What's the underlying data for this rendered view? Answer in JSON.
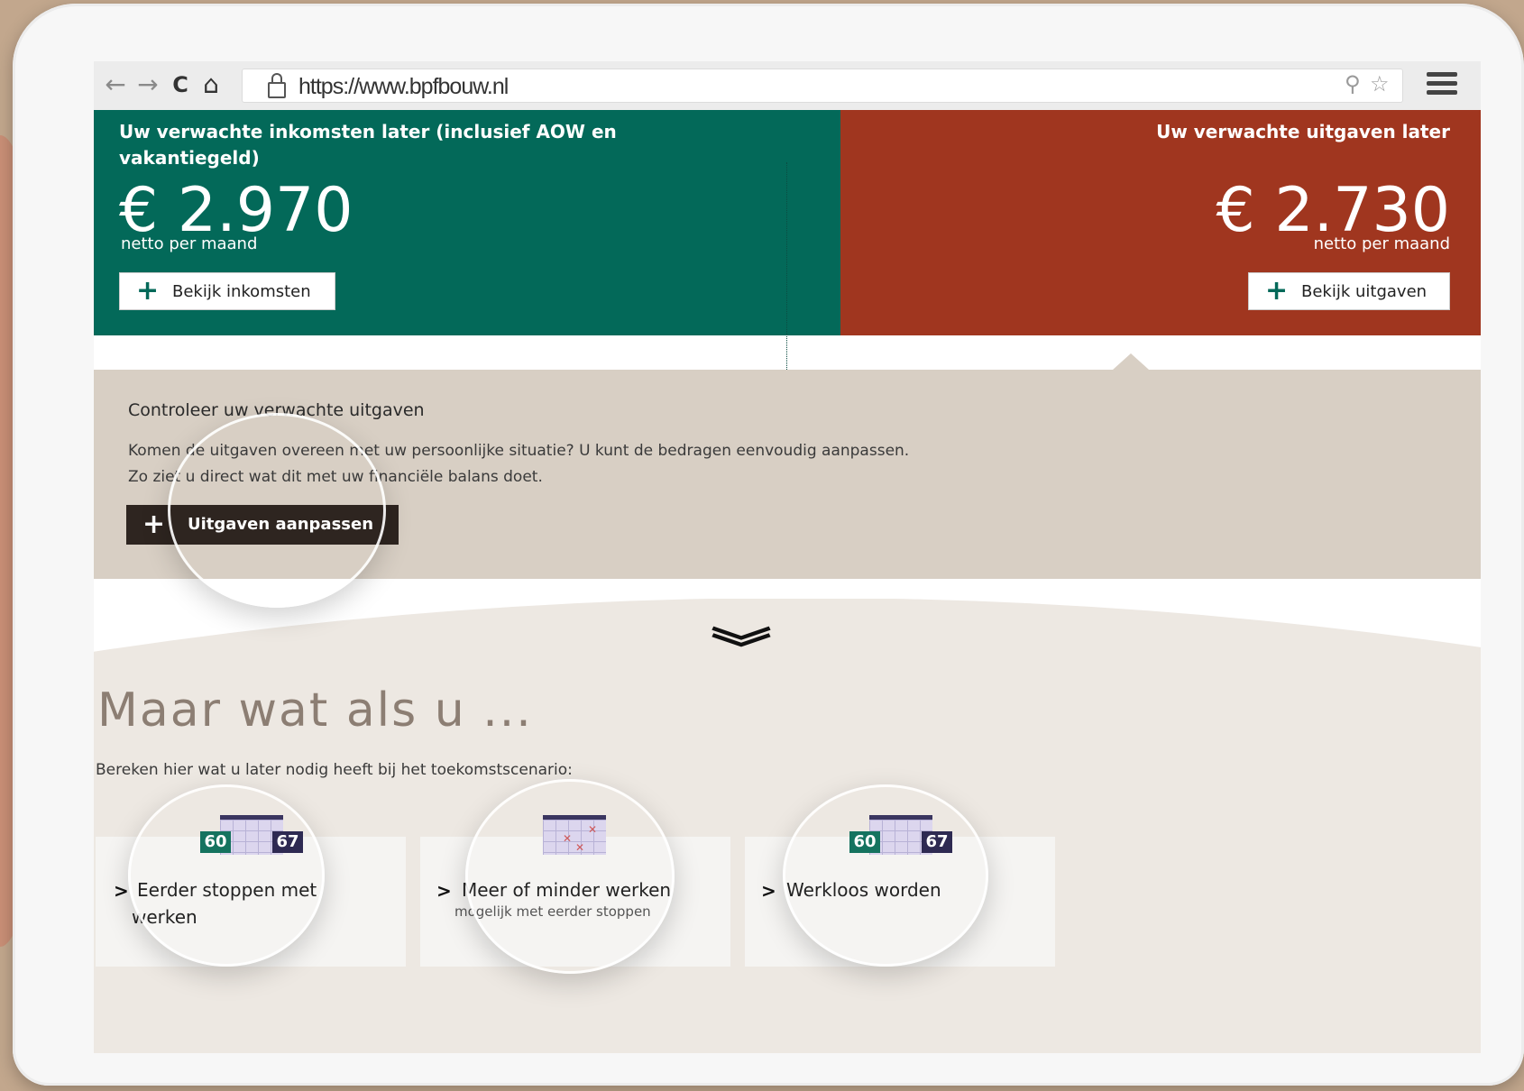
{
  "browser": {
    "url": "https://www.bpfbouw.nl",
    "back_icon": "←",
    "forward_icon": "→",
    "reload_icon": "C",
    "home_icon": "⌂",
    "zoom_icon": "⚲",
    "star_icon": "☆"
  },
  "income": {
    "title": "Uw verwachte inkomsten later (inclusief AOW en vakantiegeld)",
    "amount": "€ 2.970",
    "unit": "netto per maand",
    "button": "Bekijk inkomsten",
    "color": "#036959"
  },
  "expense": {
    "title": "Uw verwachte uitgaven later",
    "amount": "€ 2.730",
    "unit": "netto per maand",
    "button": "Bekijk uitgaven",
    "color": "#a0361f"
  },
  "check": {
    "title": "Controleer uw verwachte uitgaven",
    "line1": "Komen de uitgaven overeen met uw persoonlijke situatie? U kunt de bedragen eenvoudig aanpassen.",
    "line2": "Zo ziet u direct wat dit met uw financiële balans doet.",
    "button": "Uitgaven aanpassen"
  },
  "scenarios": {
    "heading": "Maar wat als u ...",
    "subtitle": "Bereken hier wat u later nodig heeft bij het toekomstscenario:",
    "cards": [
      {
        "label_1": "Eerder stoppen met",
        "label_2": "werken",
        "tag_a": "60",
        "tag_b": "67"
      },
      {
        "label_1": "Meer of minder werken",
        "note": "mogelijk met eerder stoppen"
      },
      {
        "label_1": "Werkloos worden",
        "tag_a": "60",
        "tag_b": "67"
      }
    ]
  },
  "common": {
    "plus": "+",
    "chevron": ">"
  }
}
